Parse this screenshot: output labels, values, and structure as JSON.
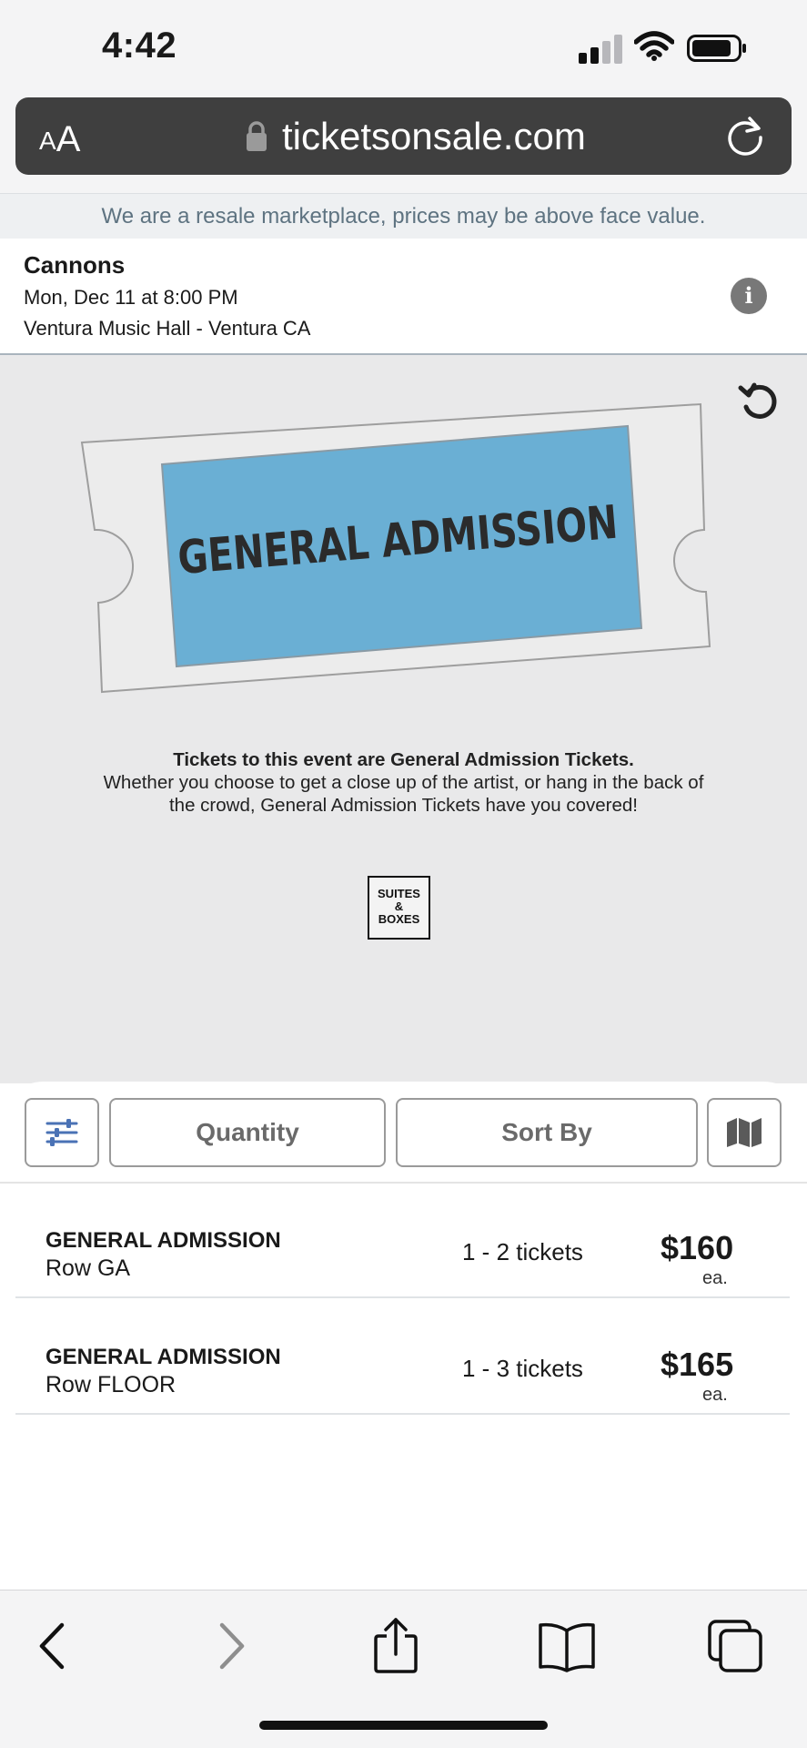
{
  "status_bar": {
    "time": "4:42"
  },
  "browser": {
    "aa_small": "A",
    "aa_big": "A",
    "url": "ticketsonsale.com"
  },
  "notice": "We are a resale marketplace, prices may be above face value.",
  "event": {
    "name": "Cannons",
    "date": "Mon, Dec 11 at 8:00 PM",
    "venue": "Ventura Music Hall - Ventura CA",
    "info_icon_glyph": "i"
  },
  "map": {
    "section_label": "GENERAL ADMISSION",
    "ticket_color": "#6aafd4",
    "description_bold": "Tickets to this event are General Admission Tickets.",
    "description": "Whether you choose to get a close up of the artist, or hang in the back of the crowd, General Admission Tickets have you covered!",
    "suites_lines": [
      "SUITES",
      "&",
      "BOXES"
    ]
  },
  "filters": {
    "quantity_label": "Quantity",
    "sort_label": "Sort By"
  },
  "listings": [
    {
      "section": "GENERAL ADMISSION",
      "row": "Row GA",
      "quantity": "1 - 2 tickets",
      "price": "$160",
      "unit": "ea."
    },
    {
      "section": "GENERAL ADMISSION",
      "row": "Row FLOOR",
      "quantity": "1 - 3 tickets",
      "price": "$165",
      "unit": "ea."
    }
  ],
  "icons": {
    "filters": "sliders-icon",
    "map": "map-icon",
    "toolbar": [
      "back-icon",
      "forward-icon",
      "share-icon",
      "bookmarks-icon",
      "tabs-icon"
    ]
  },
  "colors": {
    "accent_blue": "#4a72b5",
    "ticket_blue": "#6aafd4",
    "notice_text": "#5e7381"
  }
}
